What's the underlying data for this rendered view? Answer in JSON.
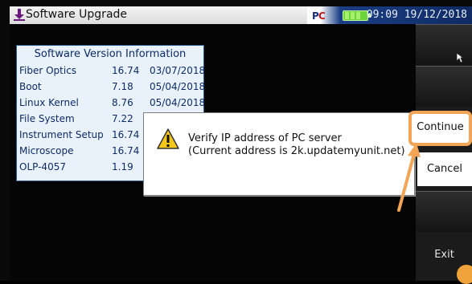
{
  "header": {
    "title": "Software Upgrade",
    "clock": "09:09 19/12/2018"
  },
  "info": {
    "title": "Software Version Information",
    "rows": [
      {
        "name": "Fiber Optics",
        "version": "16.74",
        "date": "03/07/2018"
      },
      {
        "name": "Boot",
        "version": "7.18",
        "date": "05/04/2018"
      },
      {
        "name": "Linux Kernel",
        "version": "8.76",
        "date": "05/04/2018"
      },
      {
        "name": "File System",
        "version": "7.22",
        "date": ""
      },
      {
        "name": "Instrument Setup",
        "version": "16.74",
        "date": ""
      },
      {
        "name": "Microscope",
        "version": "16.74",
        "date": ""
      },
      {
        "name": "OLP-4057",
        "version": "1.19",
        "date": ""
      }
    ]
  },
  "dialog": {
    "line1": "Verify IP address of PC server",
    "line2": "(Current address is 2k.updatemyunit.net)"
  },
  "softkeys": {
    "continue": "Continue",
    "cancel": "Cancel",
    "exit": "Exit"
  },
  "colors": {
    "highlight": "#f2a556",
    "header_bar": "#1b3f85",
    "info_text": "#0d2b66"
  }
}
